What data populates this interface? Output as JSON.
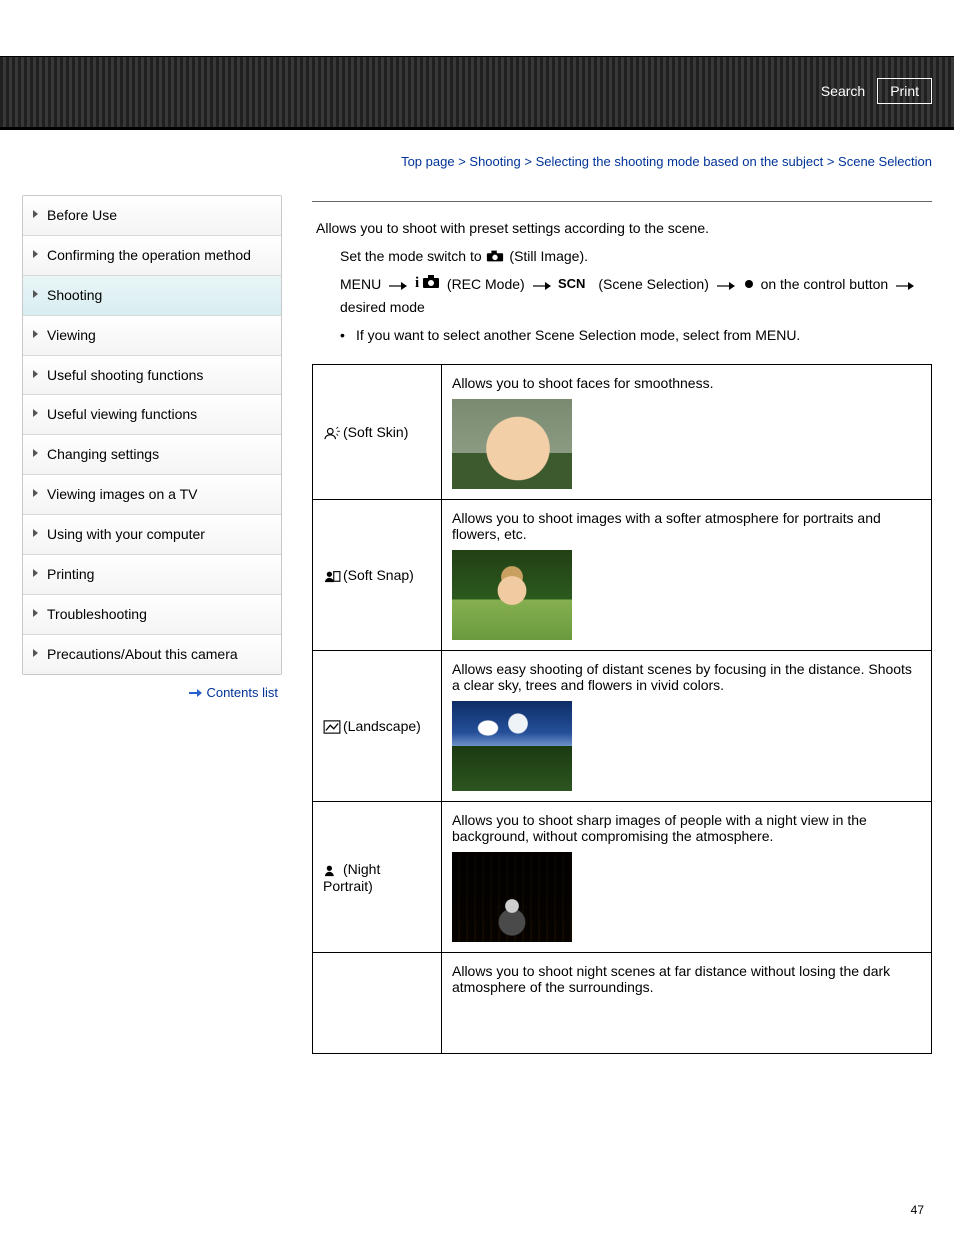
{
  "header": {
    "search": "Search",
    "print": "Print"
  },
  "breadcrumb": {
    "top": "Top page",
    "a": "Shooting",
    "b": "Selecting the shooting mode based on the subject",
    "c": "Scene Selection",
    "sep": " > "
  },
  "sidebar": {
    "items": [
      {
        "label": "Before Use"
      },
      {
        "label": "Confirming the operation method"
      },
      {
        "label": "Shooting",
        "active": true
      },
      {
        "label": "Viewing"
      },
      {
        "label": "Useful shooting functions"
      },
      {
        "label": "Useful viewing functions"
      },
      {
        "label": "Changing settings"
      },
      {
        "label": "Viewing images on a TV"
      },
      {
        "label": "Using with your computer"
      },
      {
        "label": "Printing"
      },
      {
        "label": "Troubleshooting"
      },
      {
        "label": "Precautions/About this camera"
      }
    ],
    "contents_list": "Contents list"
  },
  "main": {
    "intro": "Allows you to shoot with preset settings according to the scene.",
    "step1_a": "Set the mode switch to ",
    "step1_b": "(Still Image).",
    "step2_menu": "MENU",
    "step2_rec": "(REC Mode)",
    "step2_scn": "(Scene Selection)",
    "step2_ctrl": " on the control button ",
    "step2_tail": " desired mode",
    "bullet": "If you want to select another Scene Selection mode, select from MENU."
  },
  "scenes": [
    {
      "name": "(Soft Skin)",
      "desc": "Allows you to shoot faces for smoothness.",
      "img": "softskin"
    },
    {
      "name": "(Soft Snap)",
      "desc": "Allows you to shoot images with a softer atmosphere for portraits and flowers, etc.",
      "img": "softsnap"
    },
    {
      "name": "(Landscape)",
      "desc": "Allows easy shooting of distant scenes by focusing in the distance. Shoots a clear sky, trees and flowers in vivid colors.",
      "img": "landscape"
    },
    {
      "name": "(Night Portrait)",
      "desc": "Allows you to shoot sharp images of people with a night view in the background, without compromising the atmosphere.",
      "img": "night"
    },
    {
      "name": "",
      "desc": "Allows you to shoot night scenes at far distance without losing the dark atmosphere of the surroundings.",
      "img": ""
    }
  ],
  "page_number": "47"
}
